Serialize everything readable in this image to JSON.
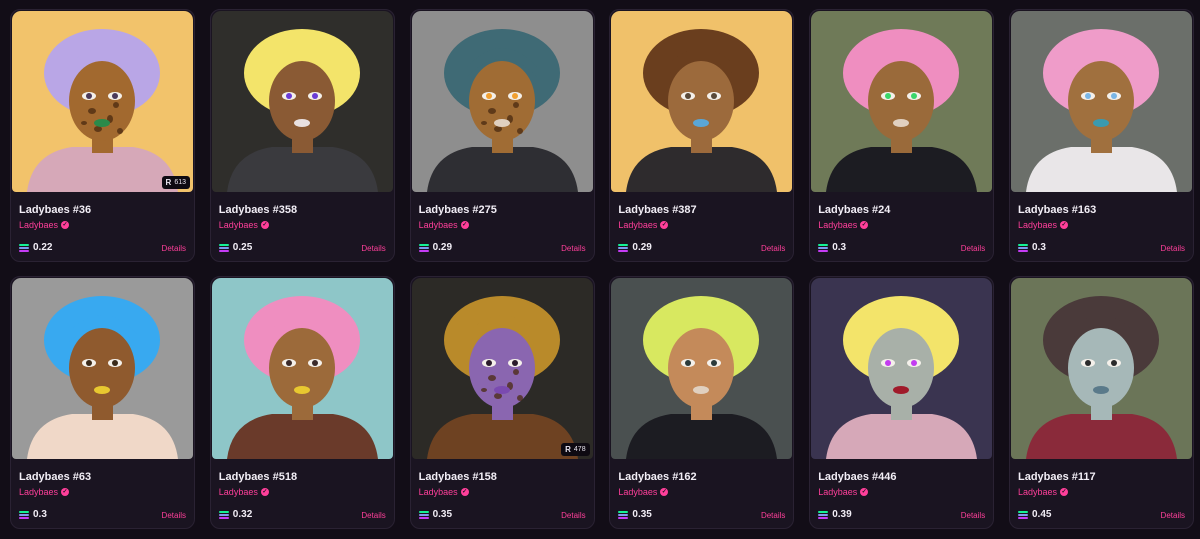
{
  "colors": {
    "accent": "#ff3f9a",
    "page_bg": "#120d17",
    "card_bg": "#1a1421"
  },
  "details_label": "Details",
  "cards": [
    {
      "name": "Ladybaes #36",
      "collection": "Ladybaes",
      "price": "0.22",
      "rank": "613",
      "bg": "#f2c36b",
      "hair": "#b9a6e6",
      "skin": "#a2692f",
      "eyes": "#4b3a5a",
      "lips": "#2a8a4a",
      "shirt": "#d6a8b8",
      "pattern": "leopard",
      "icon": "character-portrait"
    },
    {
      "name": "Ladybaes #358",
      "collection": "Ladybaes",
      "price": "0.25",
      "rank": null,
      "bg": "#2f2e2b",
      "hair": "#f3e46a",
      "skin": "#8a5a34",
      "eyes": "#6a3bd6",
      "lips": "#e8e0e0",
      "shirt": "#3a3a3e",
      "pattern": "none",
      "icon": "character-portrait"
    },
    {
      "name": "Ladybaes #275",
      "collection": "Ladybaes",
      "price": "0.29",
      "rank": null,
      "bg": "#8e8e8e",
      "hair": "#3f6a75",
      "skin": "#a06c34",
      "eyes": "#f2a030",
      "lips": "#e0d0c0",
      "shirt": "#2e2e33",
      "pattern": "leopard",
      "icon": "character-portrait"
    },
    {
      "name": "Ladybaes #387",
      "collection": "Ladybaes",
      "price": "0.29",
      "rank": null,
      "bg": "#f0c16a",
      "hair": "#6a3e1e",
      "skin": "#9c6a3c",
      "eyes": "#5a4a3a",
      "lips": "#5aa6d6",
      "shirt": "#2e2b2d",
      "pattern": "none",
      "icon": "character-portrait"
    },
    {
      "name": "Ladybaes #24",
      "collection": "Ladybaes",
      "price": "0.3",
      "rank": null,
      "bg": "#6f7a58",
      "hair": "#ef8ec0",
      "skin": "#9a6a3a",
      "eyes": "#3ad66a",
      "lips": "#e0d0c0",
      "shirt": "#1c1c22",
      "pattern": "none",
      "icon": "character-portrait"
    },
    {
      "name": "Ladybaes #163",
      "collection": "Ladybaes",
      "price": "0.3",
      "rank": null,
      "bg": "#6b6f6a",
      "hair": "#ef9cc9",
      "skin": "#a0703e",
      "eyes": "#7ab6e6",
      "lips": "#3a9ab0",
      "shirt": "#e9e6e8",
      "pattern": "none",
      "icon": "character-portrait"
    },
    {
      "name": "Ladybaes #63",
      "collection": "Ladybaes",
      "price": "0.3",
      "rank": null,
      "bg": "#9a9a9a",
      "hair": "#38a9f0",
      "skin": "#8f5a2e",
      "eyes": "#3a2a1a",
      "lips": "#e8c830",
      "shirt": "#f0d8c8",
      "pattern": "none",
      "icon": "character-portrait"
    },
    {
      "name": "Ladybaes #518",
      "collection": "Ladybaes",
      "price": "0.32",
      "rank": null,
      "bg": "#8ec6c8",
      "hair": "#ef8ec0",
      "skin": "#9c6a3a",
      "eyes": "#3a2a2a",
      "lips": "#e8c830",
      "shirt": "#6a3a2a",
      "pattern": "none",
      "icon": "character-portrait"
    },
    {
      "name": "Ladybaes #158",
      "collection": "Ladybaes",
      "price": "0.35",
      "rank": "478",
      "bg": "#2c2a26",
      "hair": "#b98a2a",
      "skin": "#8a66b0",
      "eyes": "#2a1a2a",
      "lips": "#7a4ab0",
      "shirt": "#6e4222",
      "pattern": "leopard",
      "icon": "character-portrait"
    },
    {
      "name": "Ladybaes #162",
      "collection": "Ladybaes",
      "price": "0.35",
      "rank": null,
      "bg": "#4a5050",
      "hair": "#d8e860",
      "skin": "#c48a5a",
      "eyes": "#2a3a3a",
      "lips": "#e0d0c0",
      "shirt": "#1c1c22",
      "pattern": "none",
      "icon": "character-portrait"
    },
    {
      "name": "Ladybaes #446",
      "collection": "Ladybaes",
      "price": "0.39",
      "rank": null,
      "bg": "#3a3450",
      "hair": "#f3e46a",
      "skin": "#a8b0a8",
      "eyes": "#c33cf0",
      "lips": "#a01a2a",
      "shirt": "#d6a8b8",
      "pattern": "none",
      "icon": "character-portrait"
    },
    {
      "name": "Ladybaes #117",
      "collection": "Ladybaes",
      "price": "0.45",
      "rank": null,
      "bg": "#6b7558",
      "hair": "#4a3a3a",
      "skin": "#a6b8b8",
      "eyes": "#2a2a2a",
      "lips": "#5a7a8a",
      "shirt": "#8a2a3a",
      "pattern": "none",
      "icon": "character-portrait"
    }
  ]
}
